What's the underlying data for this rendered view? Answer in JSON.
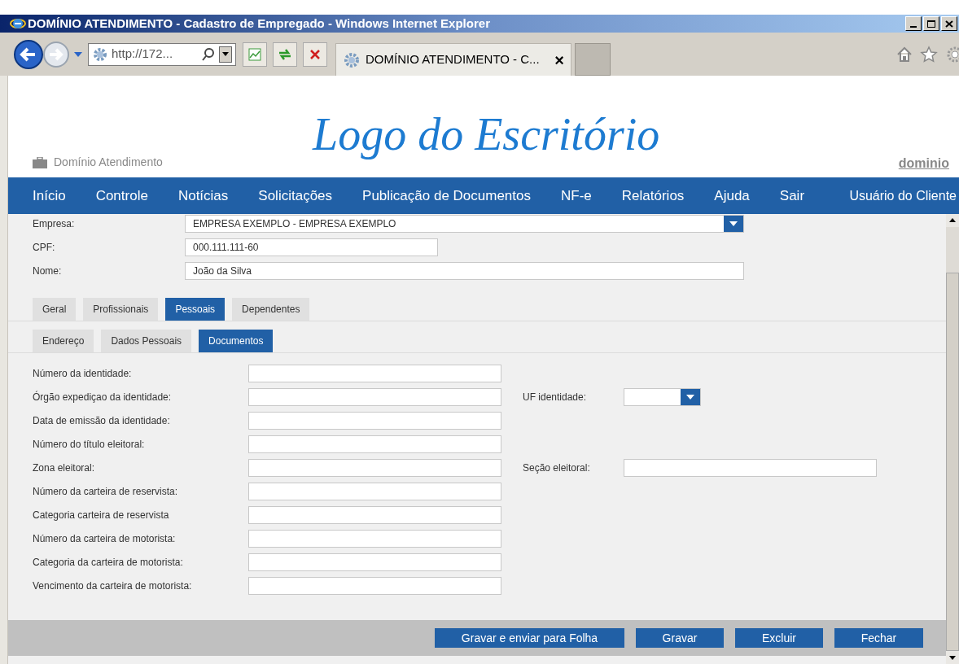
{
  "window": {
    "title": "DOMÍNIO ATENDIMENTO - Cadastro de Empregado - Windows Internet Explorer"
  },
  "address_bar": {
    "value": "http://172..."
  },
  "browser_tab": {
    "title": "DOMÍNIO ATENDIMENTO - C...",
    "close": "×"
  },
  "header": {
    "logo": "Logo do Escritório",
    "app_name": "Domínio Atendimento",
    "brand": "dominio"
  },
  "nav": {
    "items": [
      "Início",
      "Controle",
      "Notícias",
      "Solicitações",
      "Publicação de Documentos",
      "NF-e",
      "Relatórios",
      "Ajuda",
      "Sair"
    ],
    "user": "Usuário do Cliente"
  },
  "top_fields": [
    {
      "label": "Empresa:",
      "kind": "select",
      "value": "EMPRESA EXEMPLO - EMPRESA EXEMPLO"
    },
    {
      "label": "CPF:",
      "kind": "text",
      "value": "000.111.111-60"
    },
    {
      "label": "Nome:",
      "kind": "text",
      "value": "João da Silva"
    }
  ],
  "tabs": [
    {
      "label": "Geral",
      "selected": false
    },
    {
      "label": "Profissionais",
      "selected": false
    },
    {
      "label": "Pessoais",
      "selected": true
    },
    {
      "label": "Dependentes",
      "selected": false
    }
  ],
  "subtabs": [
    {
      "label": "Endereço",
      "selected": false
    },
    {
      "label": "Dados Pessoais",
      "selected": false
    },
    {
      "label": "Documentos",
      "selected": true
    }
  ],
  "form_rows": [
    {
      "label": "Número da identidade:"
    },
    {
      "label": "Órgão expediçao da identidade:",
      "side": {
        "label": "UF identidade:",
        "kind": "select"
      }
    },
    {
      "label": "Data de emissão da identidade:"
    },
    {
      "label": "Número do título eleitoral:"
    },
    {
      "label": "Zona eleitoral:",
      "side": {
        "label": "Seção eleitoral:",
        "kind": "text"
      }
    },
    {
      "label": "Número da carteira de reservista:"
    },
    {
      "label": "Categoria carteira de reservista"
    },
    {
      "label": "Número da carteira de motorista:"
    },
    {
      "label": "Categoria da carteira de motorista:"
    },
    {
      "label": "Vencimento da carteira de motorista:"
    }
  ],
  "buttons": [
    "Gravar e enviar para Folha",
    "Gravar",
    "Excluir",
    "Fechar"
  ]
}
